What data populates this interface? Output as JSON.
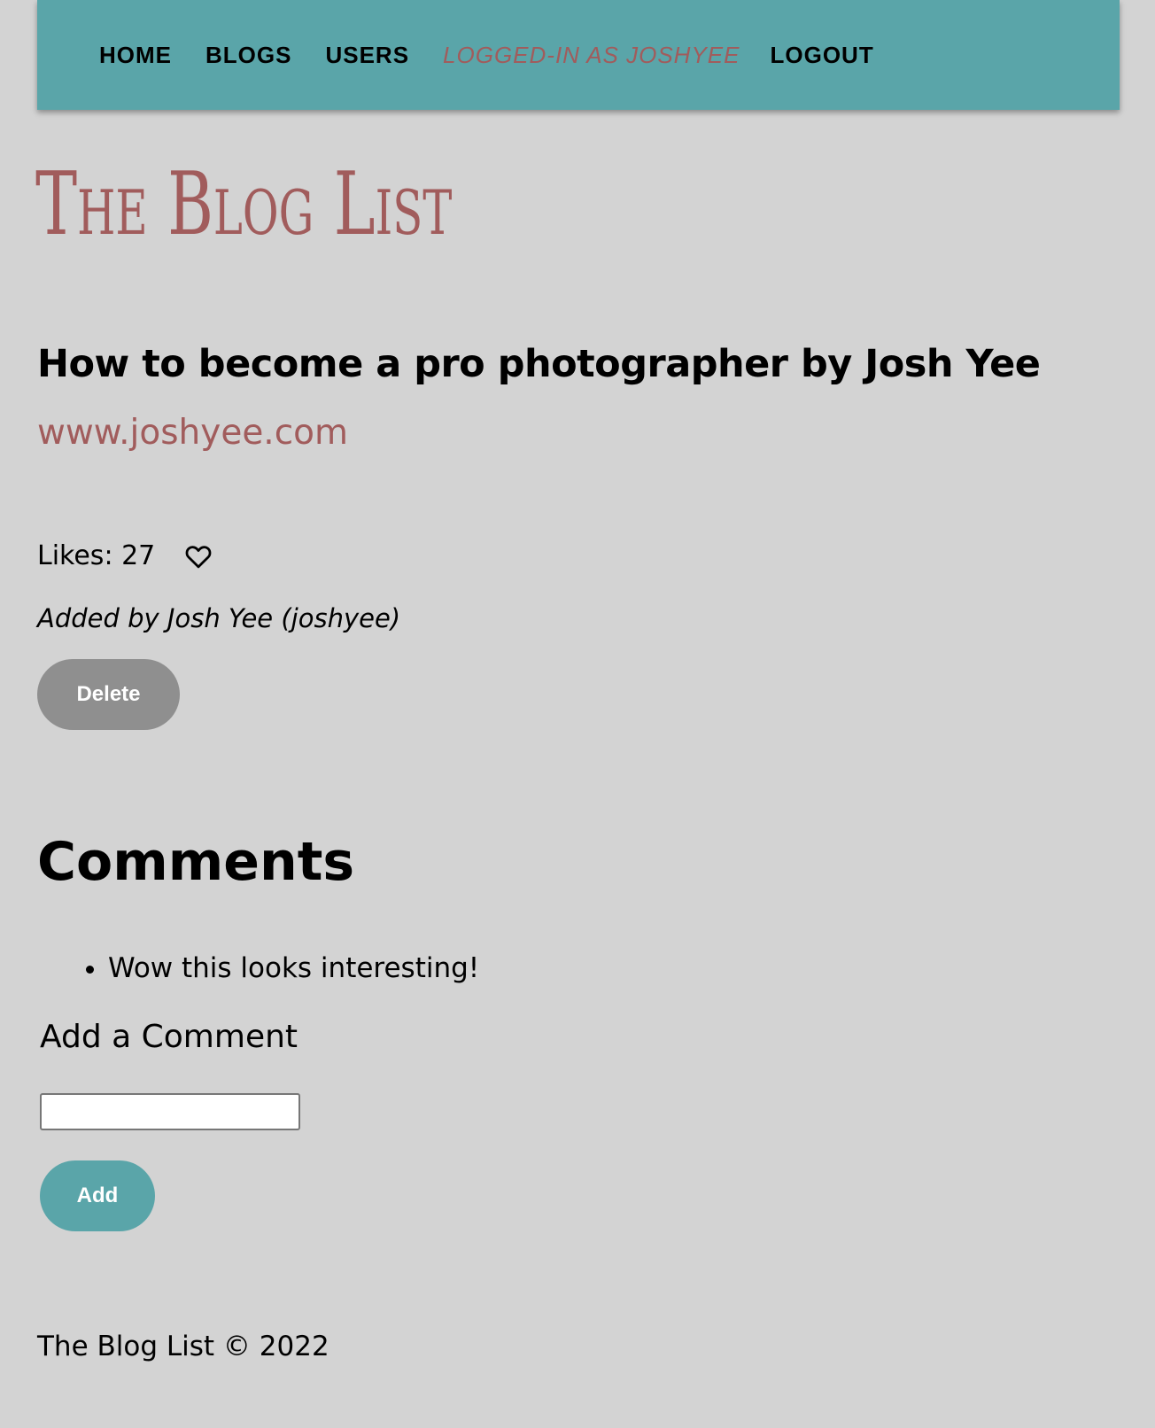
{
  "nav": {
    "home": "HOME",
    "blogs": "BLOGS",
    "users": "USERS",
    "logged_in": "LOGGED-IN AS JOSHYEE",
    "logout": "LOGOUT"
  },
  "site": {
    "title": "The Blog List"
  },
  "blog": {
    "title": "How to become a pro photographer by Josh Yee",
    "url": "www.joshyee.com",
    "likes_text": "Likes: 27",
    "added_by": "Added by Josh Yee (joshyee)",
    "delete_label": "Delete"
  },
  "comments": {
    "heading": "Comments",
    "items": [
      "Wow this looks interesting!"
    ],
    "add_label": "Add a Comment",
    "input_value": "",
    "add_button": "Add"
  },
  "footer": {
    "text": "The Blog List © 2022"
  },
  "colors": {
    "accent": "#5aa5a9",
    "brand": "#a15c5c",
    "background": "#d3d3d3",
    "delete_button": "#8f8f8f"
  },
  "icons": {
    "like": "heart-outline-icon"
  }
}
